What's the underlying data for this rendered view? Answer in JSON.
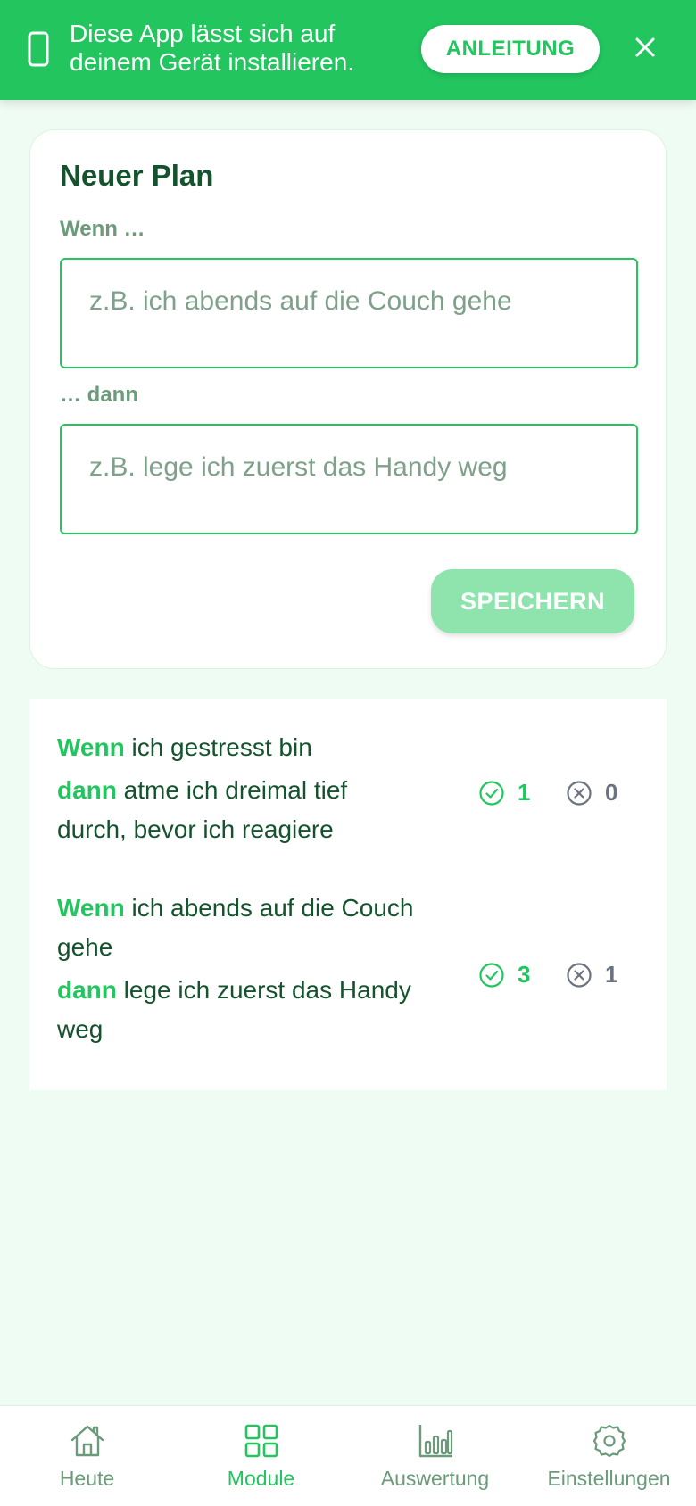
{
  "banner": {
    "message": "Diese App lässt sich auf deinem Gerät installieren.",
    "guide_label": "ANLEITUNG",
    "icons": {
      "device": "phone-icon",
      "close": "close-icon"
    }
  },
  "new_plan": {
    "title": "Neuer Plan",
    "if_label": "Wenn …",
    "if_placeholder": "z.B. ich abends auf die Couch gehe",
    "then_label": "… dann",
    "then_placeholder": "z.B. lege ich zuerst das Handy weg",
    "save_label": "SPEICHERN"
  },
  "plans": [
    {
      "if_keyword": "Wenn",
      "if_lines": [
        "ich gestresst bin"
      ],
      "then_keyword": "dann",
      "then_first": "atme ich dreimal tief",
      "then_rest": [
        "durch, bevor ich reagiere"
      ],
      "success": "1",
      "failure": "0"
    },
    {
      "if_keyword": "Wenn",
      "if_first": "ich abends auf die Couch",
      "if_rest": [
        "gehe"
      ],
      "then_keyword": "dann",
      "then_first": "lege ich zuerst das Handy",
      "then_rest": [
        "weg"
      ],
      "success": "3",
      "failure": "1"
    }
  ],
  "nav": {
    "items": [
      {
        "label": "Heute",
        "icon": "home-icon"
      },
      {
        "label": "Module",
        "icon": "grid-icon",
        "active": true
      },
      {
        "label": "Auswertung",
        "icon": "bar-chart-icon"
      },
      {
        "label": "Einstellungen",
        "icon": "gear-icon"
      }
    ]
  },
  "colors": {
    "accent": "#22c55e",
    "dark_text": "#14532d",
    "muted_green": "#6b9b7a",
    "background": "#effcf4",
    "disabled_button": "#8fe3ad"
  }
}
